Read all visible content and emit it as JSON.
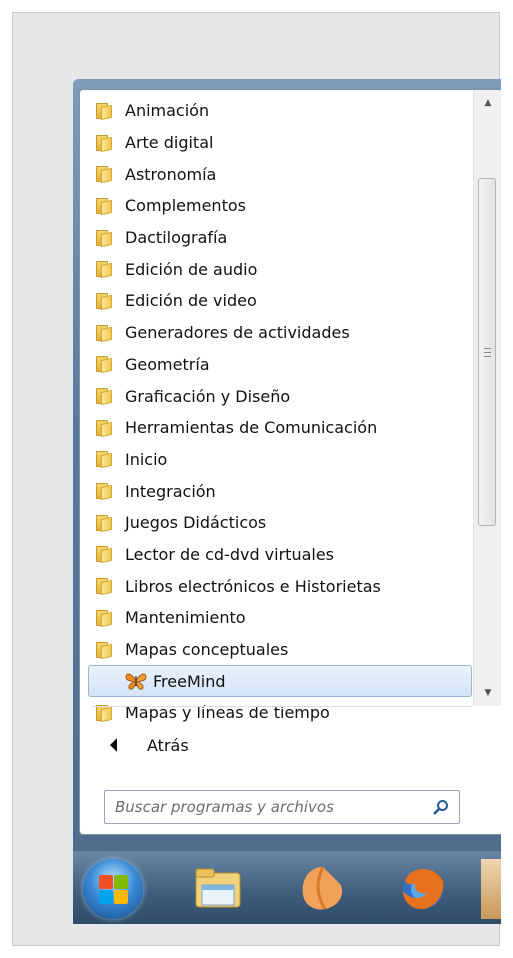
{
  "start_menu": {
    "programs": [
      {
        "label": "Animación",
        "type": "folder"
      },
      {
        "label": "Arte digital",
        "type": "folder"
      },
      {
        "label": "Astronomía",
        "type": "folder"
      },
      {
        "label": "Complementos",
        "type": "folder"
      },
      {
        "label": "Dactilografía",
        "type": "folder"
      },
      {
        "label": "Edición de audio",
        "type": "folder"
      },
      {
        "label": "Edición de video",
        "type": "folder"
      },
      {
        "label": "Generadores de actividades",
        "type": "folder"
      },
      {
        "label": "Geometría",
        "type": "folder"
      },
      {
        "label": "Graficación y Diseño",
        "type": "folder"
      },
      {
        "label": "Herramientas de Comunicación",
        "type": "folder"
      },
      {
        "label": "Inicio",
        "type": "folder"
      },
      {
        "label": "Integración",
        "type": "folder"
      },
      {
        "label": "Juegos Didácticos",
        "type": "folder"
      },
      {
        "label": "Lector de cd-dvd virtuales",
        "type": "folder"
      },
      {
        "label": "Libros electrónicos e Historietas",
        "type": "folder"
      },
      {
        "label": "Mantenimiento",
        "type": "folder"
      },
      {
        "label": "Mapas conceptuales",
        "type": "folder"
      },
      {
        "label": "FreeMind",
        "type": "app",
        "icon": "butterfly-icon",
        "selected": true
      },
      {
        "label": "Mapas y líneas de tiempo",
        "type": "folder"
      }
    ],
    "back_label": "Atrás",
    "search": {
      "placeholder": "Buscar programas y archivos"
    }
  },
  "taskbar": {
    "items": [
      "start-orb",
      "windows-explorer-icon",
      "app-icon",
      "firefox-icon"
    ]
  }
}
